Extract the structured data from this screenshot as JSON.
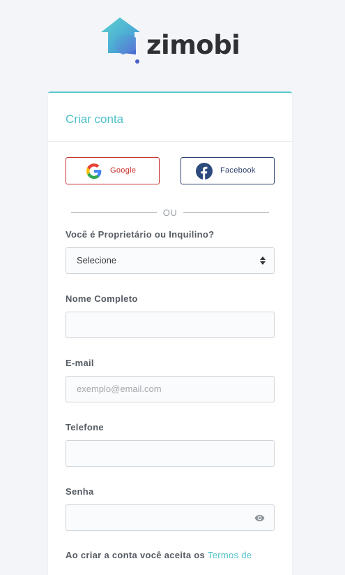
{
  "brand": {
    "name": "zimobi"
  },
  "card": {
    "title": "Criar conta",
    "google_label": "Google",
    "facebook_label": "Facebook",
    "divider_text": "OU"
  },
  "form": {
    "tenant_type": {
      "label": "Você é Proprietário ou Inquilino?",
      "value": "Selecione"
    },
    "full_name": {
      "label": "Nome Completo",
      "value": "",
      "placeholder": ""
    },
    "email": {
      "label": "E-mail",
      "value": "",
      "placeholder": "exemplo@email.com"
    },
    "phone": {
      "label": "Telefone",
      "value": "",
      "placeholder": ""
    },
    "password": {
      "label": "Senha",
      "value": "",
      "placeholder": ""
    }
  },
  "terms": {
    "prefix": "Ao criar a conta você aceita os ",
    "link": "Termos de"
  },
  "colors": {
    "accent": "#4ec0c9",
    "google": "#c9302c",
    "facebook": "#2c3e6e"
  },
  "icons": [
    "zimobi-house-logo-icon",
    "google-icon",
    "facebook-icon",
    "select-arrows-icon",
    "eye-icon"
  ]
}
